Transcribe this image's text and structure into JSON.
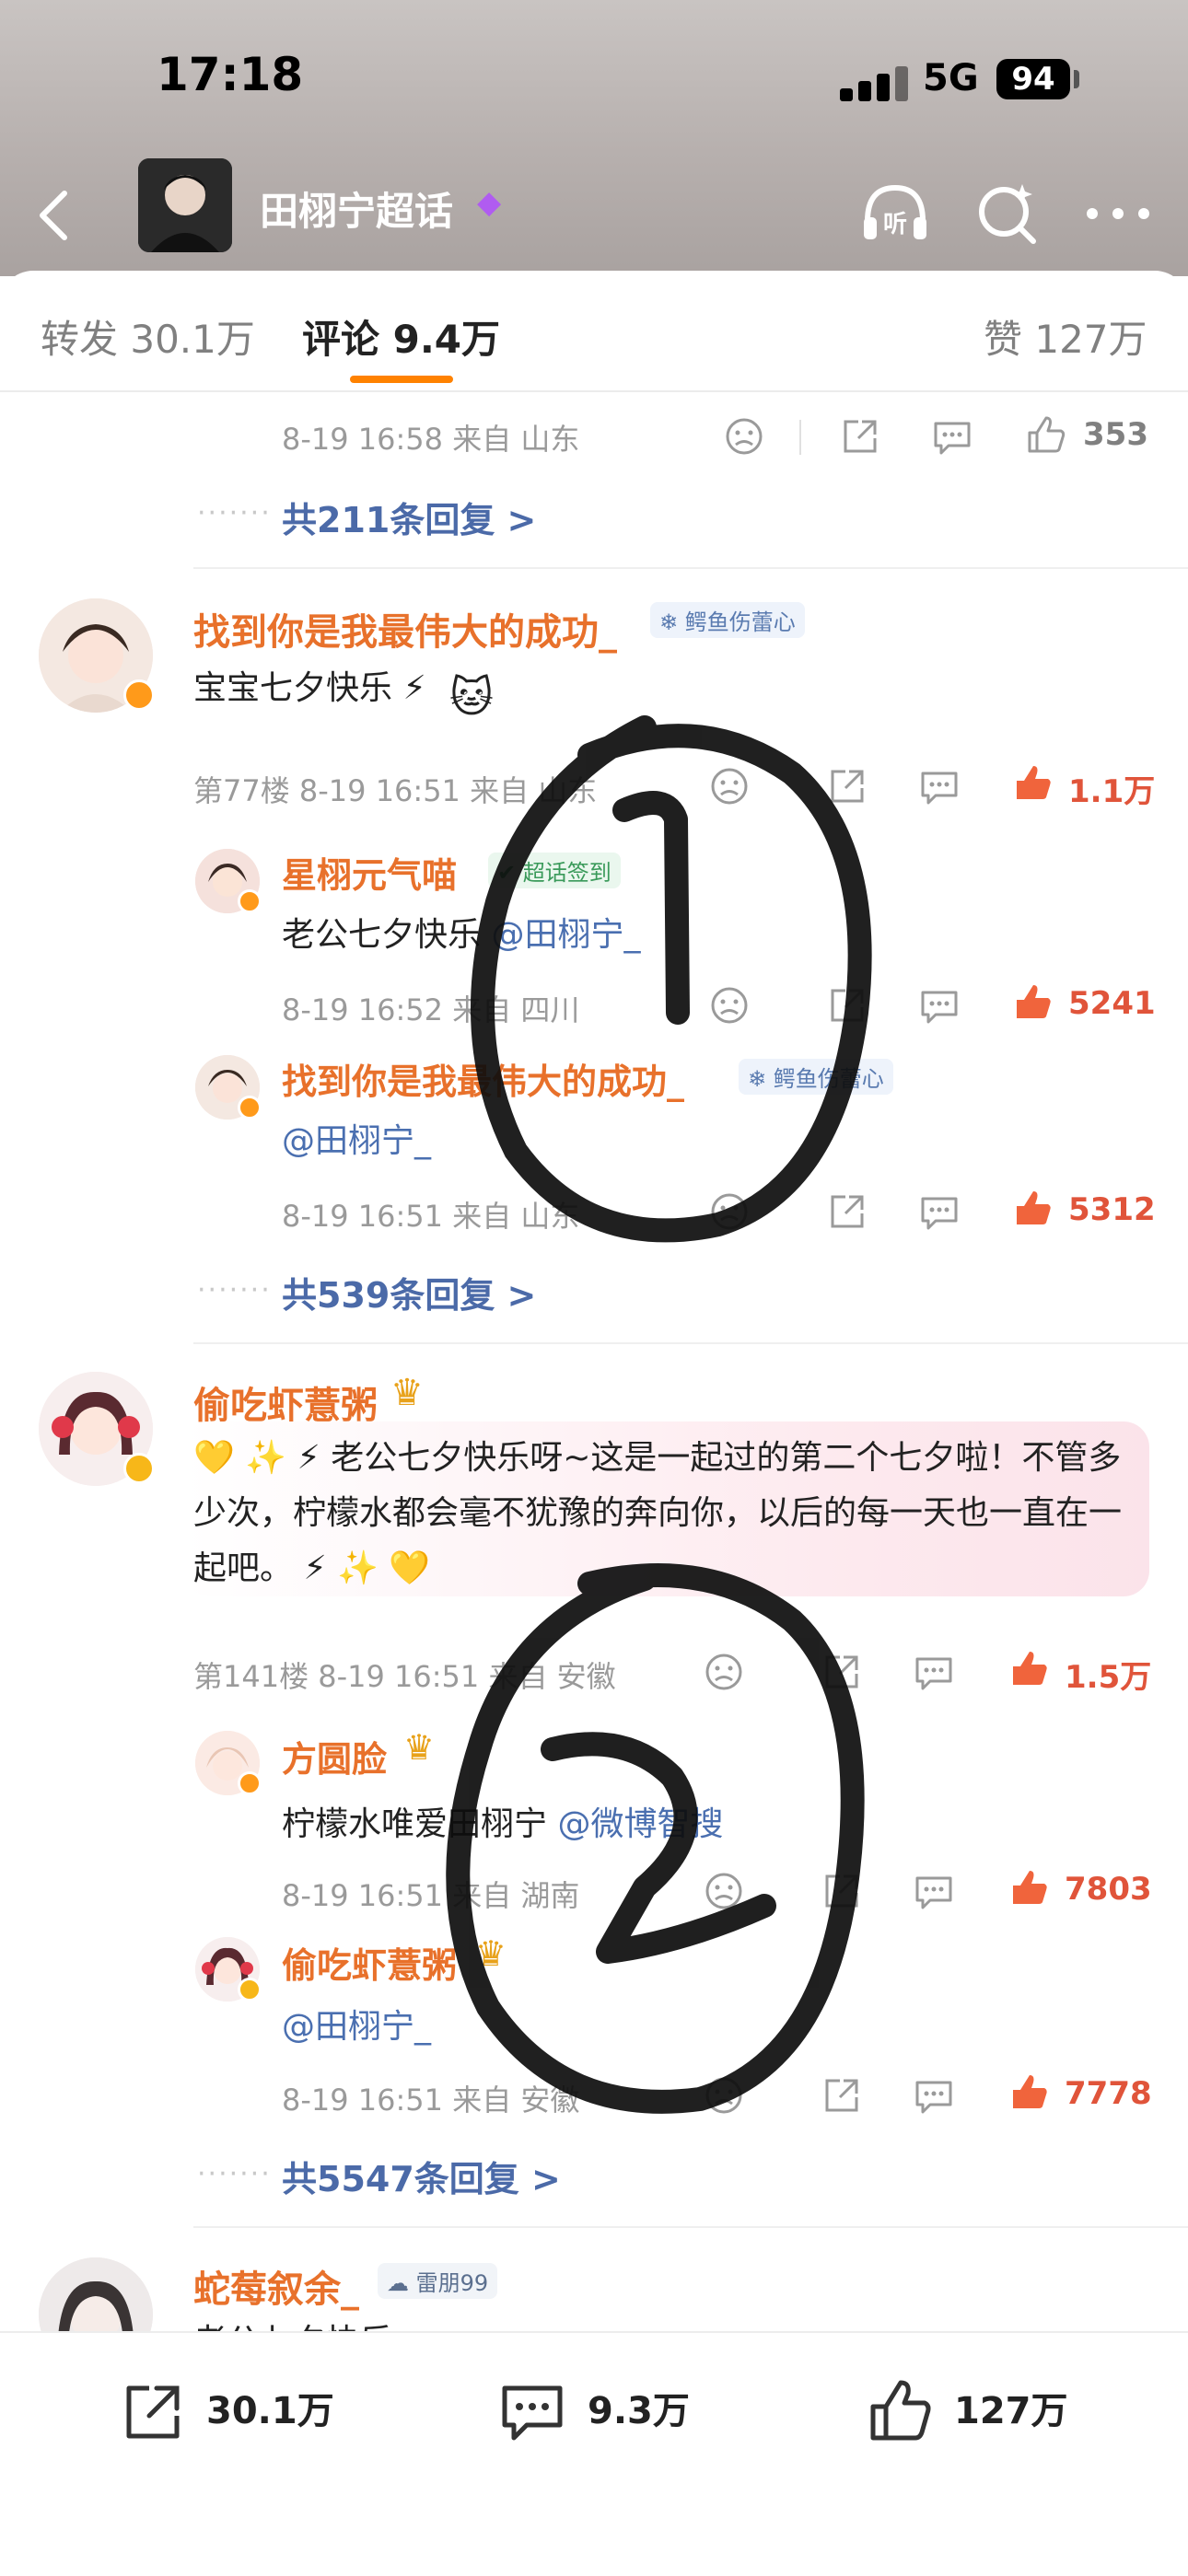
{
  "status": {
    "time": "17:18",
    "network": "5G",
    "battery": "94"
  },
  "header": {
    "title": "田栩宁超话",
    "listen_icon_label": "听"
  },
  "tabs": {
    "repost": "转发 30.1万",
    "comments": "评论 9.4万",
    "likes": "赞 127万"
  },
  "prev_comment": {
    "meta": "8-19 16:58 来自 山东",
    "likes": "353",
    "replies_link": "共211条回复 >"
  },
  "comments": [
    {
      "name": "找到你是我最伟大的成功_",
      "badge": "鳄鱼伤蕾心",
      "text": "宝宝七夕快乐 ⚡",
      "meta": "第77楼 8-19 16:51 来自 山东",
      "likes": "1.1万",
      "replies": [
        {
          "name": "星栩元气喵",
          "badge": "超话签到",
          "text_plain": "老公七夕快乐 ",
          "mention": "@田栩宁_",
          "meta": "8-19 16:52 来自 四川",
          "likes": "5241"
        },
        {
          "name": "找到你是我最伟大的成功_",
          "badge": "鳄鱼伤蕾心",
          "mention": "@田栩宁_",
          "meta": "8-19 16:51 来自 山东",
          "likes": "5312"
        }
      ],
      "replies_link": "共539条回复 >"
    },
    {
      "name": "偷吃虾薏粥",
      "text": "💛 ✨ ⚡ 老公七夕快乐呀~这是一起过的第二个七夕啦！不管多少次，柠檬水都会毫不犹豫的奔向你，以后的每一天也一直在一起吧。 ⚡ ✨ 💛",
      "meta": "第141楼 8-19 16:51 来自 安徽",
      "likes": "1.5万",
      "replies": [
        {
          "name": "方圆脸",
          "text_plain": "柠檬水唯爱田栩宁 ",
          "mention": "@微博智搜",
          "meta": "8-19 16:51 来自 湖南",
          "likes": "7803"
        },
        {
          "name": "偷吃虾薏粥",
          "mention": "@田栩宁_",
          "meta": "8-19 16:51 来自 安徽",
          "likes": "7778"
        }
      ],
      "replies_link": "共5547条回复 >"
    },
    {
      "name": "蛇莓叙余_",
      "badge": "雷朋99",
      "text": "老公七夕快乐"
    }
  ],
  "annotations": {
    "circle_1": "1",
    "circle_2": "2"
  },
  "bottom_bar": {
    "reposts": "30.1万",
    "comments": "9.3万",
    "likes": "127万"
  },
  "colors": {
    "accent": "#ff8200",
    "username": "#e8712b",
    "link": "#4b6aa8",
    "like_active": "#e0543a"
  }
}
